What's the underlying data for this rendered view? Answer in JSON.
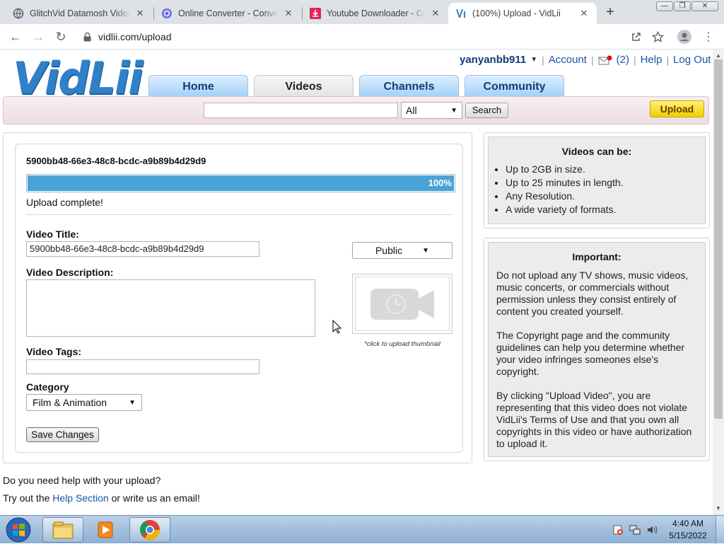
{
  "browser": {
    "tabs": [
      {
        "title": "GlitchVid Datamosh Videos"
      },
      {
        "title": "Online Converter - Convert"
      },
      {
        "title": "Youtube Downloader - Con"
      },
      {
        "title": "(100%) Upload - VidLii"
      }
    ],
    "new_tab": "+",
    "window_controls": {
      "minimize": "—",
      "maximize": "❐",
      "close": "✕"
    },
    "url": "vidlii.com/upload"
  },
  "site": {
    "logo": "VidLii",
    "user": {
      "name": "yanyanbb911",
      "account": "Account",
      "inbox_count": "(2)",
      "help": "Help",
      "logout": "Log Out"
    },
    "nav": [
      {
        "label": "Home"
      },
      {
        "label": "Videos"
      },
      {
        "label": "Channels"
      },
      {
        "label": "Community"
      }
    ],
    "search": {
      "value": "",
      "scope": "All",
      "button": "Search",
      "upload_button": "Upload"
    }
  },
  "upload": {
    "file_id": "5900bb48-66e3-48c8-bcdc-a9b89b4d29d9",
    "progress": {
      "percent": 100,
      "label": "100%"
    },
    "status": "Upload complete!",
    "title_label": "Video Title:",
    "title_value": "5900bb48-66e3-48c8-bcdc-a9b89b4d29d9",
    "privacy": "Public",
    "description_label": "Video Description:",
    "description_value": "",
    "thumbnail_hint": "*click to upload thumbnail",
    "tags_label": "Video Tags:",
    "tags_value": "",
    "category_label": "Category",
    "category_value": "Film & Animation",
    "save_button": "Save Changes"
  },
  "sidebar": {
    "can_be": {
      "heading": "Videos can be:",
      "items": [
        "Up to 2GB in size.",
        "Up to 25 minutes in length.",
        "Any Resolution.",
        "A wide variety of formats."
      ]
    },
    "important": {
      "heading": "Important:",
      "p1": "Do not upload any TV shows, music videos, music concerts, or commercials without permission unless they consist entirely of content you created yourself.",
      "p2": "The Copyright page and the community guidelines can help you determine whether your video infringes someones else's copyright.",
      "p3": "By clicking \"Upload Video\", you are representing that this video does not violate VidLii's Terms of Use and that you own all copyrights in this video or have authorization to upload it."
    }
  },
  "footer": {
    "line1": "Do you need help with your upload?",
    "line2_prefix": "Try out the",
    "help_link": "Help Section",
    "line2_mid": "or write us",
    "email_link": "an email!"
  },
  "taskbar": {
    "time": "4:40 AM",
    "date": "5/15/2022"
  },
  "colors": {
    "progress": "#4aa3d8",
    "brand_blue": "#2f80c9",
    "upload_btn": "#f5d100",
    "link": "#1a55a8"
  }
}
